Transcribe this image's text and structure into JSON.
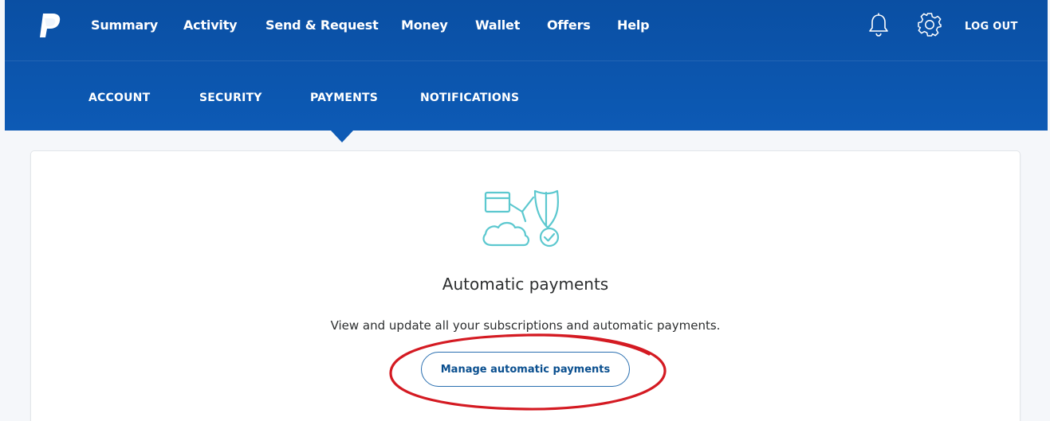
{
  "header": {
    "nav": [
      "Summary",
      "Activity",
      "Send & Request",
      "Money",
      "Wallet",
      "Offers",
      "Help"
    ],
    "logout_label": "LOG OUT",
    "icons": [
      "paypal-logo",
      "bell-icon",
      "gear-icon"
    ]
  },
  "subnav": {
    "tabs": [
      "ACCOUNT",
      "SECURITY",
      "PAYMENTS",
      "NOTIFICATIONS"
    ],
    "active_tab": "PAYMENTS"
  },
  "card": {
    "title": "Automatic payments",
    "description": "View and update all your subscriptions and automatic payments.",
    "button_label": "Manage automatic payments",
    "illustration": "card-cloud-shield-icon"
  },
  "colors": {
    "header_blue": "#0d5ab5",
    "illustration_teal": "#5cc8cf",
    "button_border": "#2a6fb0",
    "highlight_red": "#d41a22"
  }
}
